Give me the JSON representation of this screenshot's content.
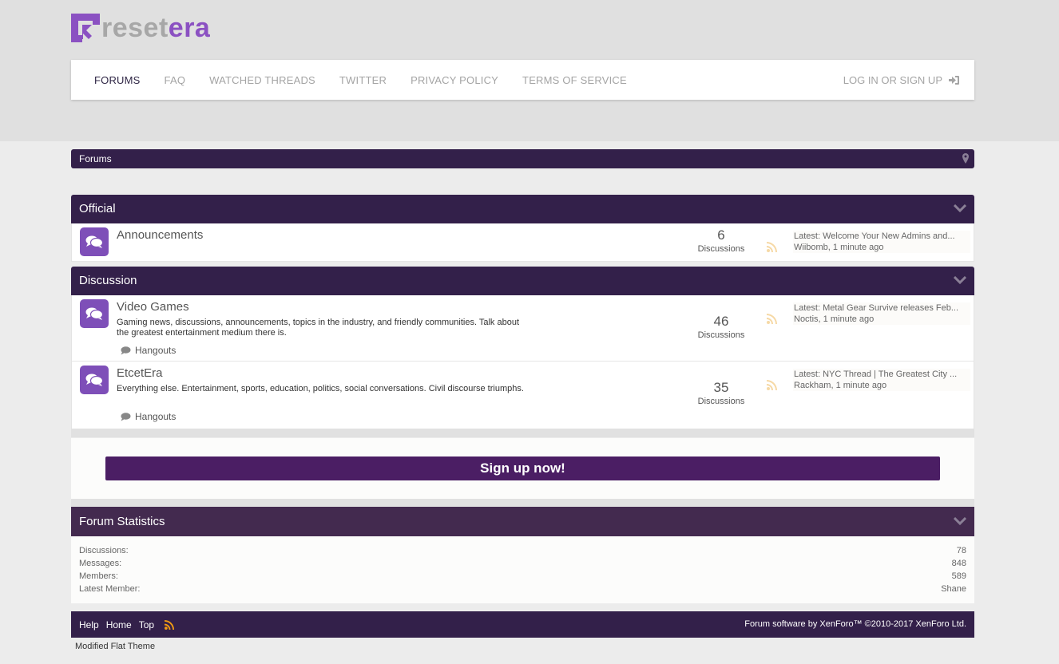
{
  "brand": {
    "logo_part1": "reset",
    "logo_part2": "era",
    "logo_icon": "resetera-logo-icon",
    "accent_color": "#8b51c2",
    "dark_color": "#33204a"
  },
  "nav": {
    "items": [
      {
        "label": "FORUMS",
        "active": true
      },
      {
        "label": "FAQ"
      },
      {
        "label": "WATCHED THREADS"
      },
      {
        "label": "TWITTER"
      },
      {
        "label": "PRIVACY POLICY"
      },
      {
        "label": "TERMS OF SERVICE"
      }
    ],
    "login_label": "LOG IN OR SIGN UP",
    "login_icon": "sign-in-icon"
  },
  "breadcrumb": {
    "label": "Forums",
    "icon": "map-pin-icon"
  },
  "categories": [
    {
      "title": "Official",
      "forums": [
        {
          "title": "Announcements",
          "description": "",
          "count": "6",
          "count_label": "Discussions",
          "latest_title": "Latest: Welcome Your New Admins and...",
          "latest_meta": "Wiibomb, 1 minute ago"
        }
      ]
    },
    {
      "title": "Discussion",
      "forums": [
        {
          "title": "Video Games",
          "description": "Gaming news, discussions, announcements, topics in the industry, and friendly communities. Talk about the greatest entertainment medium there is.",
          "subforum": "Hangouts",
          "count": "46",
          "count_label": "Discussions",
          "latest_title": "Latest: Metal Gear Survive releases Feb...",
          "latest_meta": "Noctis, 1 minute ago"
        },
        {
          "title": "EtcetEra",
          "description": "Everything else. Entertainment, sports, education, politics, social conversations. Civil discourse triumphs.",
          "subforum": "Hangouts",
          "count": "35",
          "count_label": "Discussions",
          "latest_title": "Latest: NYC Thread | The Greatest City ...",
          "latest_meta": "Rackham, 1 minute ago"
        }
      ]
    }
  ],
  "signup": {
    "label": "Sign up now!",
    "color": "#4b1e64"
  },
  "stats": {
    "title": "Forum Statistics",
    "rows": [
      {
        "label": "Discussions:",
        "value": "78"
      },
      {
        "label": "Messages:",
        "value": "848"
      },
      {
        "label": "Members:",
        "value": "589"
      },
      {
        "label": "Latest Member:",
        "value": "Shane"
      }
    ]
  },
  "footer": {
    "links": [
      "Help",
      "Home",
      "Top"
    ],
    "rss_icon": "rss-icon",
    "copyright": "Forum software by XenForo™ ©2010-2017 XenForo Ltd.",
    "theme_note": "Modified Flat Theme"
  }
}
